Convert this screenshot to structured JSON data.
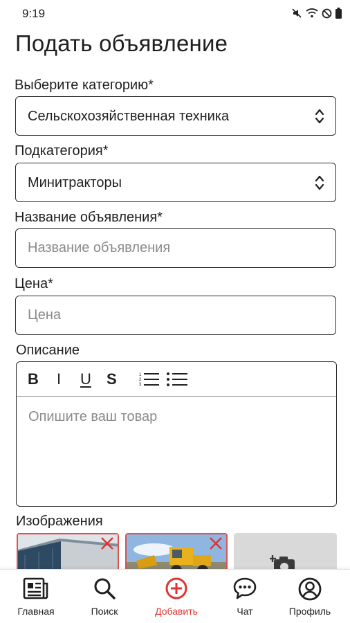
{
  "status_bar": {
    "time": "9:19",
    "icons": [
      "mute-icon",
      "wifi-icon",
      "dnd-icon",
      "battery-icon"
    ]
  },
  "page_title": "Подать объявление",
  "category": {
    "label": "Выберите категорию*",
    "value": "Сельскохозяйственная техника"
  },
  "subcategory": {
    "label": "Подкатегория*",
    "value": "Минитракторы"
  },
  "title_field": {
    "label": "Название объявления*",
    "placeholder": "Название объявления",
    "value": ""
  },
  "price_field": {
    "label": "Цена*",
    "placeholder": "Цена",
    "value": ""
  },
  "description": {
    "label": "Описание",
    "toolbar": {
      "bold": "B",
      "italic": "I",
      "underline": "U",
      "strike": "S",
      "icons": [
        "ordered-list-icon",
        "bullet-list-icon"
      ]
    },
    "placeholder": "Опишите ваш товар"
  },
  "images": {
    "label": "Изображения",
    "thumbnails": [
      "building-photo",
      "loader-tractor-photo"
    ],
    "add_icon": "add-photo-icon"
  },
  "nav": {
    "items": [
      {
        "label": "Главная",
        "icon": "news-icon",
        "active": false
      },
      {
        "label": "Поиск",
        "icon": "search-icon",
        "active": false
      },
      {
        "label": "Добавить",
        "icon": "add-circle-icon",
        "active": true
      },
      {
        "label": "Чат",
        "icon": "chat-icon",
        "active": false
      },
      {
        "label": "Профиль",
        "icon": "profile-icon",
        "active": false
      }
    ]
  },
  "colors": {
    "accent": "#e0332f",
    "border": "#2b2b2b",
    "placeholder": "#8a8a8a"
  }
}
